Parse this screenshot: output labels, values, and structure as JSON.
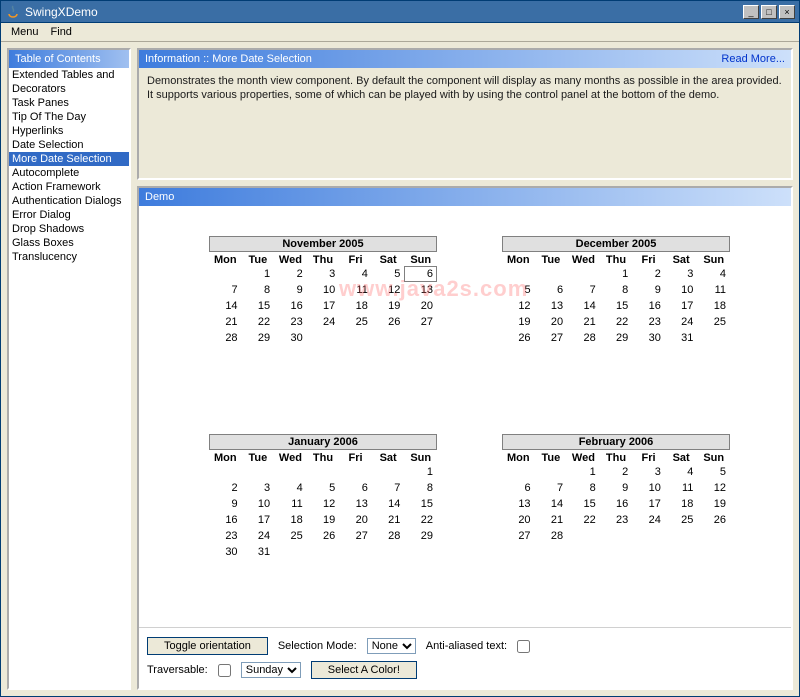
{
  "window": {
    "title": "SwingXDemo"
  },
  "menu": {
    "items": [
      "Menu",
      "Find"
    ]
  },
  "sidebar": {
    "header": "Table of Contents",
    "items": [
      "Extended Tables and",
      "Decorators",
      "Task Panes",
      "Tip Of The Day",
      "Hyperlinks",
      "Date Selection",
      "More Date Selection",
      "Autocomplete",
      "Action Framework",
      "Authentication Dialogs",
      "Error Dialog",
      "Drop Shadows",
      "Glass Boxes",
      "Translucency"
    ],
    "selected_index": 6
  },
  "info": {
    "header": "Information :: More Date Selection",
    "read_more": "Read More...",
    "body": "Demonstrates the month view component. By default the component will display as many months as possible in the area provided. It supports various properties, some of which can be played with by using the control panel at the bottom of the demo."
  },
  "demo": {
    "header": "Demo"
  },
  "dow": [
    "Mon",
    "Tue",
    "Wed",
    "Thu",
    "Fri",
    "Sat",
    "Sun"
  ],
  "months": [
    {
      "title": "November 2005",
      "offset": 1,
      "ndays": 30,
      "today": 6
    },
    {
      "title": "December 2005",
      "offset": 3,
      "ndays": 31,
      "today": null
    },
    {
      "title": "January 2006",
      "offset": 6,
      "ndays": 31,
      "today": null
    },
    {
      "title": "February 2006",
      "offset": 2,
      "ndays": 28,
      "today": null
    }
  ],
  "controls": {
    "toggle": "Toggle orientation",
    "sel_mode_label": "Selection Mode:",
    "sel_mode_value": "None",
    "aa_label": "Anti-aliased text:",
    "aa_checked": false,
    "traversable_label": "Traversable:",
    "traversable_checked": false,
    "day_value": "Sunday",
    "select_color": "Select A Color!"
  },
  "watermark": "www.java2s.com"
}
